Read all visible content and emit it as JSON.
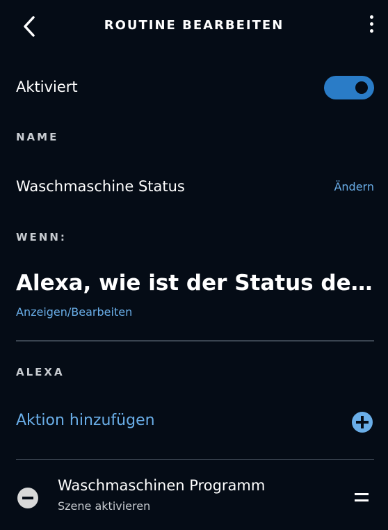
{
  "header": {
    "title": "ROUTINE BEARBEITEN",
    "back_icon": "chevron-left-icon",
    "more_icon": "more-vertical-icon"
  },
  "enabled": {
    "label": "Aktiviert",
    "toggle_on": true,
    "accent_color": "#2a7cc7"
  },
  "name_section": {
    "heading": "NAME",
    "value": "Waschmaschine Status",
    "change_link": "Ändern"
  },
  "when_section": {
    "heading": "WENN:",
    "trigger_phrase": "Alexa, wie ist der Status der Waschmaschine",
    "view_edit_link": "Anzeigen/Bearbeiten"
  },
  "alexa_section": {
    "heading": "ALEXA",
    "add_action_label": "Aktion hinzufügen",
    "add_icon": "plus-circle-icon",
    "actions": [
      {
        "title": "Waschmaschinen Programm",
        "subtitle": "Szene aktivieren",
        "remove_icon": "minus-circle-icon",
        "drag_icon": "drag-handle-icon"
      }
    ]
  },
  "colors": {
    "background": "#050c16",
    "link": "#6aaee8",
    "divider": "#3a4450"
  }
}
